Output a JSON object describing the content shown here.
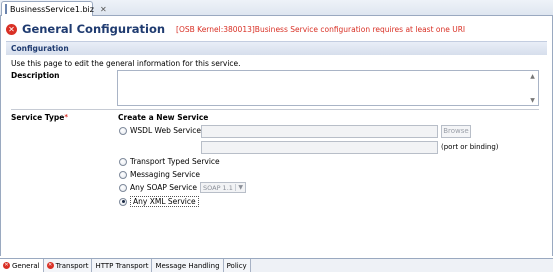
{
  "editor_tab": {
    "title": "BusinessService1.biz",
    "close_symbol": "✕"
  },
  "header": {
    "title": "General Configuration",
    "error_message": "[OSB Kernel:380013]Business Service configuration requires at least one URI",
    "error_icon_symbol": "✕"
  },
  "section": {
    "title": "Configuration"
  },
  "intro_text": "Use this page to edit the general information for this service.",
  "description": {
    "label": "Description",
    "value": ""
  },
  "service_type": {
    "label": "Service Type",
    "required_mark": "*",
    "heading": "Create a New Service",
    "options": [
      {
        "label": "WSDL Web Service",
        "selected": false
      },
      {
        "label": "Transport Typed Service",
        "selected": false
      },
      {
        "label": "Messaging Service",
        "selected": false
      },
      {
        "label": "Any SOAP Service",
        "selected": false
      },
      {
        "label": "Any XML Service",
        "selected": true
      }
    ],
    "wsdl_value": "",
    "binding_value": "",
    "browse_label": "Browse",
    "binding_hint": "(port or binding)",
    "soap_version": "SOAP 1.1"
  },
  "bottom_tabs": [
    {
      "label": "General",
      "has_error": true,
      "active": true
    },
    {
      "label": "Transport",
      "has_error": true,
      "active": false
    },
    {
      "label": "HTTP Transport",
      "has_error": false,
      "active": false
    },
    {
      "label": "Message Handling",
      "has_error": false,
      "active": false
    },
    {
      "label": "Policy",
      "has_error": false,
      "active": false
    }
  ],
  "colors": {
    "error": "#d93025",
    "title": "#1f3b70"
  }
}
